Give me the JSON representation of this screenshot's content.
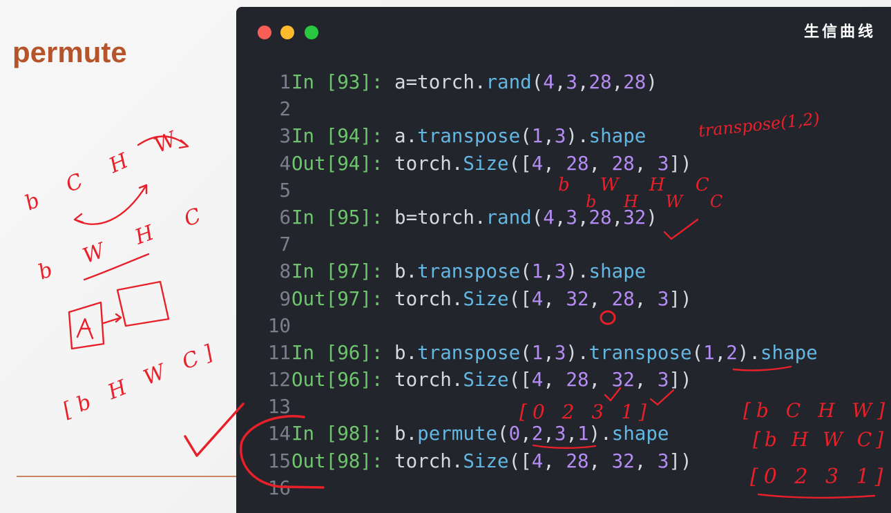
{
  "slide": {
    "title": "permute"
  },
  "terminal": {
    "watermark": "生信曲线",
    "window_controls": [
      "close",
      "minimize",
      "maximize"
    ],
    "lines": [
      {
        "n": "1",
        "prompt": "In [93]:",
        "parts": [
          [
            "t",
            "a"
          ],
          [
            "p",
            "="
          ],
          [
            "t",
            "torch"
          ],
          [
            "p",
            "."
          ],
          [
            "f",
            "rand"
          ],
          [
            "p",
            "("
          ],
          [
            "n",
            "4"
          ],
          [
            "p",
            ","
          ],
          [
            "n",
            "3"
          ],
          [
            "p",
            ","
          ],
          [
            "n",
            "28"
          ],
          [
            "p",
            ","
          ],
          [
            "n",
            "28"
          ],
          [
            "p",
            ")"
          ]
        ]
      },
      {
        "n": "2",
        "prompt": "",
        "parts": []
      },
      {
        "n": "3",
        "prompt": "In [94]:",
        "parts": [
          [
            "t",
            "a"
          ],
          [
            "p",
            "."
          ],
          [
            "f",
            "transpose"
          ],
          [
            "p",
            "("
          ],
          [
            "n",
            "1"
          ],
          [
            "p",
            ","
          ],
          [
            "n",
            "3"
          ],
          [
            "p",
            ")."
          ],
          [
            "f",
            "shape"
          ]
        ]
      },
      {
        "n": "4",
        "prompt": "Out[94]:",
        "parts": [
          [
            "t",
            "torch"
          ],
          [
            "p",
            "."
          ],
          [
            "f",
            "Size"
          ],
          [
            "p",
            "(["
          ],
          [
            "n",
            "4"
          ],
          [
            "p",
            ", "
          ],
          [
            "n",
            "28"
          ],
          [
            "p",
            ", "
          ],
          [
            "n",
            "28"
          ],
          [
            "p",
            ", "
          ],
          [
            "n",
            "3"
          ],
          [
            "p",
            "])"
          ]
        ]
      },
      {
        "n": "5",
        "prompt": "",
        "parts": []
      },
      {
        "n": "6",
        "prompt": "In [95]:",
        "parts": [
          [
            "t",
            "b"
          ],
          [
            "p",
            "="
          ],
          [
            "t",
            "torch"
          ],
          [
            "p",
            "."
          ],
          [
            "f",
            "rand"
          ],
          [
            "p",
            "("
          ],
          [
            "n",
            "4"
          ],
          [
            "p",
            ","
          ],
          [
            "n",
            "3"
          ],
          [
            "p",
            ","
          ],
          [
            "n",
            "28"
          ],
          [
            "p",
            ","
          ],
          [
            "n",
            "32"
          ],
          [
            "p",
            ")"
          ]
        ]
      },
      {
        "n": "7",
        "prompt": "",
        "parts": []
      },
      {
        "n": "8",
        "prompt": "In [97]:",
        "parts": [
          [
            "t",
            "b"
          ],
          [
            "p",
            "."
          ],
          [
            "f",
            "transpose"
          ],
          [
            "p",
            "("
          ],
          [
            "n",
            "1"
          ],
          [
            "p",
            ","
          ],
          [
            "n",
            "3"
          ],
          [
            "p",
            ")."
          ],
          [
            "f",
            "shape"
          ]
        ]
      },
      {
        "n": "9",
        "prompt": "Out[97]:",
        "parts": [
          [
            "t",
            "torch"
          ],
          [
            "p",
            "."
          ],
          [
            "f",
            "Size"
          ],
          [
            "p",
            "(["
          ],
          [
            "n",
            "4"
          ],
          [
            "p",
            ", "
          ],
          [
            "n",
            "32"
          ],
          [
            "p",
            ", "
          ],
          [
            "n",
            "28"
          ],
          [
            "p",
            ", "
          ],
          [
            "n",
            "3"
          ],
          [
            "p",
            "])"
          ]
        ]
      },
      {
        "n": "10",
        "prompt": "",
        "parts": []
      },
      {
        "n": "11",
        "prompt": "In [96]:",
        "parts": [
          [
            "t",
            "b"
          ],
          [
            "p",
            "."
          ],
          [
            "f",
            "transpose"
          ],
          [
            "p",
            "("
          ],
          [
            "n",
            "1"
          ],
          [
            "p",
            ","
          ],
          [
            "n",
            "3"
          ],
          [
            "p",
            ")."
          ],
          [
            "f",
            "transpose"
          ],
          [
            "p",
            "("
          ],
          [
            "n",
            "1"
          ],
          [
            "p",
            ","
          ],
          [
            "n",
            "2"
          ],
          [
            "p",
            ")."
          ],
          [
            "f",
            "shape"
          ]
        ]
      },
      {
        "n": "12",
        "prompt": "Out[96]:",
        "parts": [
          [
            "t",
            "torch"
          ],
          [
            "p",
            "."
          ],
          [
            "f",
            "Size"
          ],
          [
            "p",
            "(["
          ],
          [
            "n",
            "4"
          ],
          [
            "p",
            ", "
          ],
          [
            "n",
            "28"
          ],
          [
            "p",
            ", "
          ],
          [
            "n",
            "32"
          ],
          [
            "p",
            ", "
          ],
          [
            "n",
            "3"
          ],
          [
            "p",
            "])"
          ]
        ]
      },
      {
        "n": "13",
        "prompt": "",
        "parts": []
      },
      {
        "n": "14",
        "prompt": "In [98]:",
        "parts": [
          [
            "t",
            "b"
          ],
          [
            "p",
            "."
          ],
          [
            "f",
            "permute"
          ],
          [
            "p",
            "("
          ],
          [
            "n",
            "0"
          ],
          [
            "p",
            ","
          ],
          [
            "n",
            "2"
          ],
          [
            "p",
            ","
          ],
          [
            "n",
            "3"
          ],
          [
            "p",
            ","
          ],
          [
            "n",
            "1"
          ],
          [
            "p",
            ")."
          ],
          [
            "f",
            "shape"
          ]
        ]
      },
      {
        "n": "15",
        "prompt": "Out[98]:",
        "parts": [
          [
            "t",
            "torch"
          ],
          [
            "p",
            "."
          ],
          [
            "f",
            "Size"
          ],
          [
            "p",
            "(["
          ],
          [
            "n",
            "4"
          ],
          [
            "p",
            ", "
          ],
          [
            "n",
            "28"
          ],
          [
            "p",
            ", "
          ],
          [
            "n",
            "32"
          ],
          [
            "p",
            ", "
          ],
          [
            "n",
            "3"
          ],
          [
            "p",
            "])"
          ]
        ]
      },
      {
        "n": "16",
        "prompt": "",
        "parts": []
      }
    ]
  },
  "annotations": {
    "transpose_note": "transpose(1,2)",
    "bwhc": "b W H C",
    "bhwc": "b H W C",
    "left_bchw": "b C H W",
    "left_bwhc": "b W H C",
    "left_bhwc_bracket": "[b H W C]",
    "perm_idx": "[0 2 3 1]",
    "right_bchw": "[b C H W]",
    "right_bhwc": "[b H W C]",
    "right_idx": "[0 2 3 1]",
    "zero_mark": "0"
  },
  "colors": {
    "terminal_bg": "#22252c",
    "prompt": "#6fc56e",
    "number": "#b58cf3",
    "function": "#64b7e2",
    "text": "#d6d9df",
    "line_number": "#7b808d",
    "ink": "#e8202a",
    "title": "#b5532a"
  }
}
